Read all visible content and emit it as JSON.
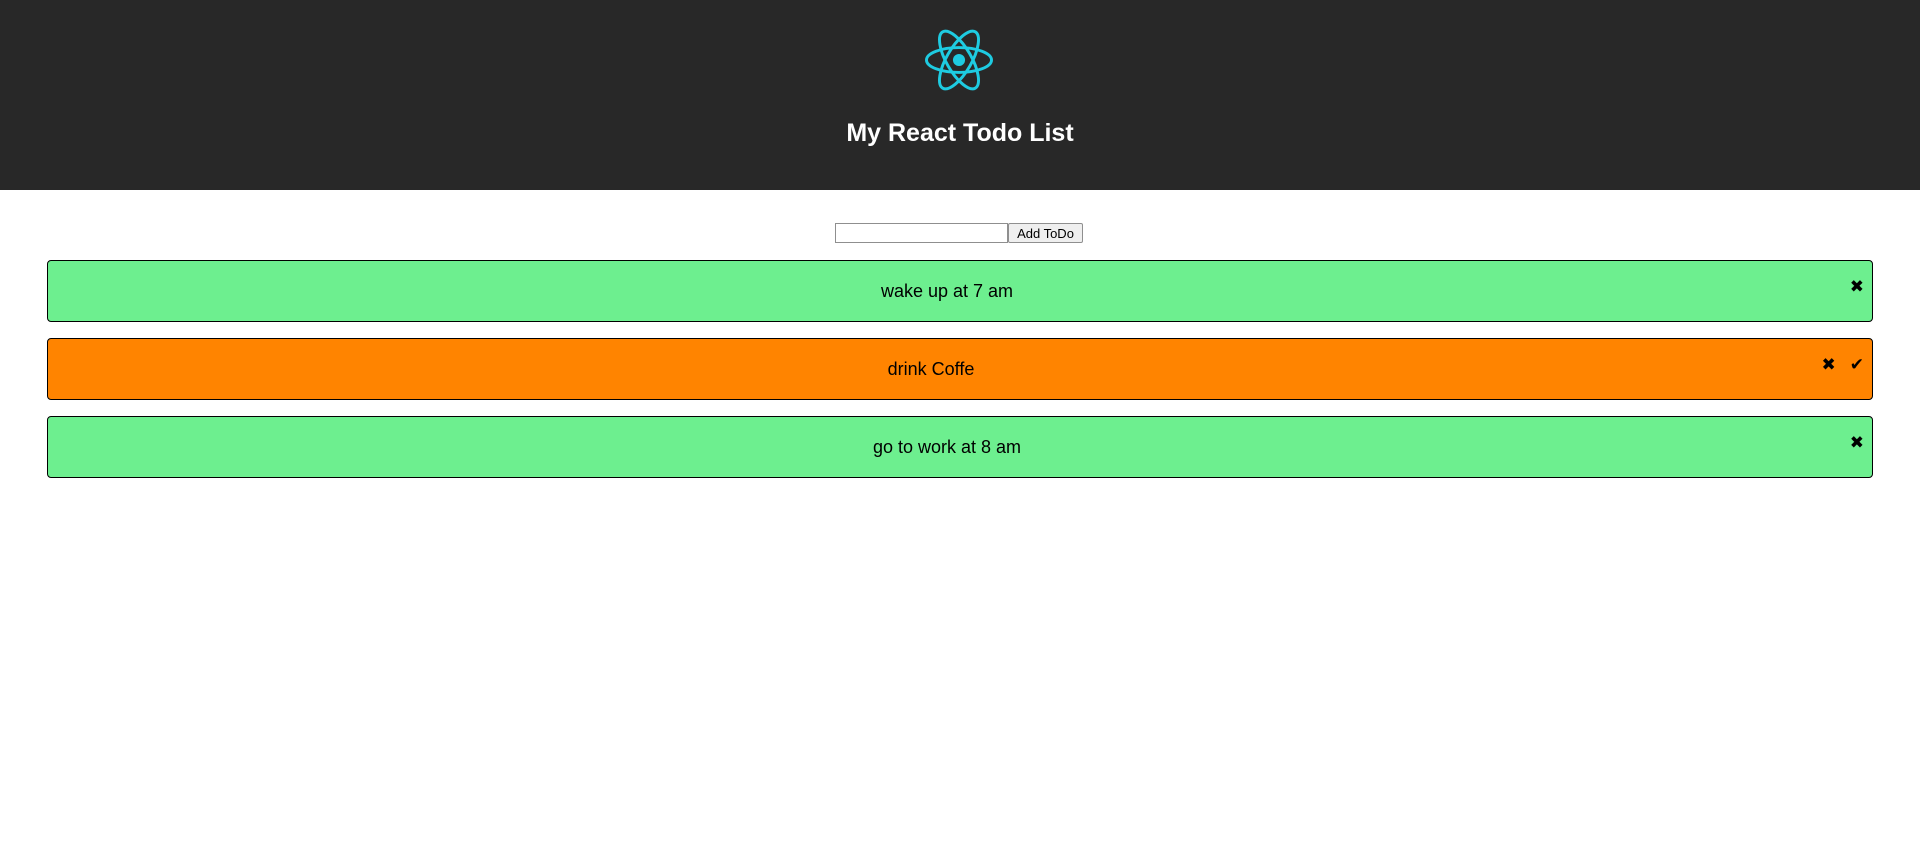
{
  "header": {
    "logo_icon": "react-logo-icon",
    "logo_color": "#1ecbe1",
    "background": "#282828",
    "title": "My React Todo List"
  },
  "add_form": {
    "input_value": "",
    "input_placeholder": "",
    "button_label": "Add ToDo"
  },
  "colors": {
    "pending": "#6def8f",
    "selected": "#ff8400"
  },
  "todos": [
    {
      "text": "wake up at 7 am",
      "color": "#6def8f",
      "delete_icon": "✖",
      "complete_icon": ""
    },
    {
      "text": "drink Coffe",
      "color": "#ff8400",
      "delete_icon": "✖",
      "complete_icon": "✔"
    },
    {
      "text": "go to work at 8 am",
      "color": "#6def8f",
      "delete_icon": "✖",
      "complete_icon": ""
    }
  ]
}
